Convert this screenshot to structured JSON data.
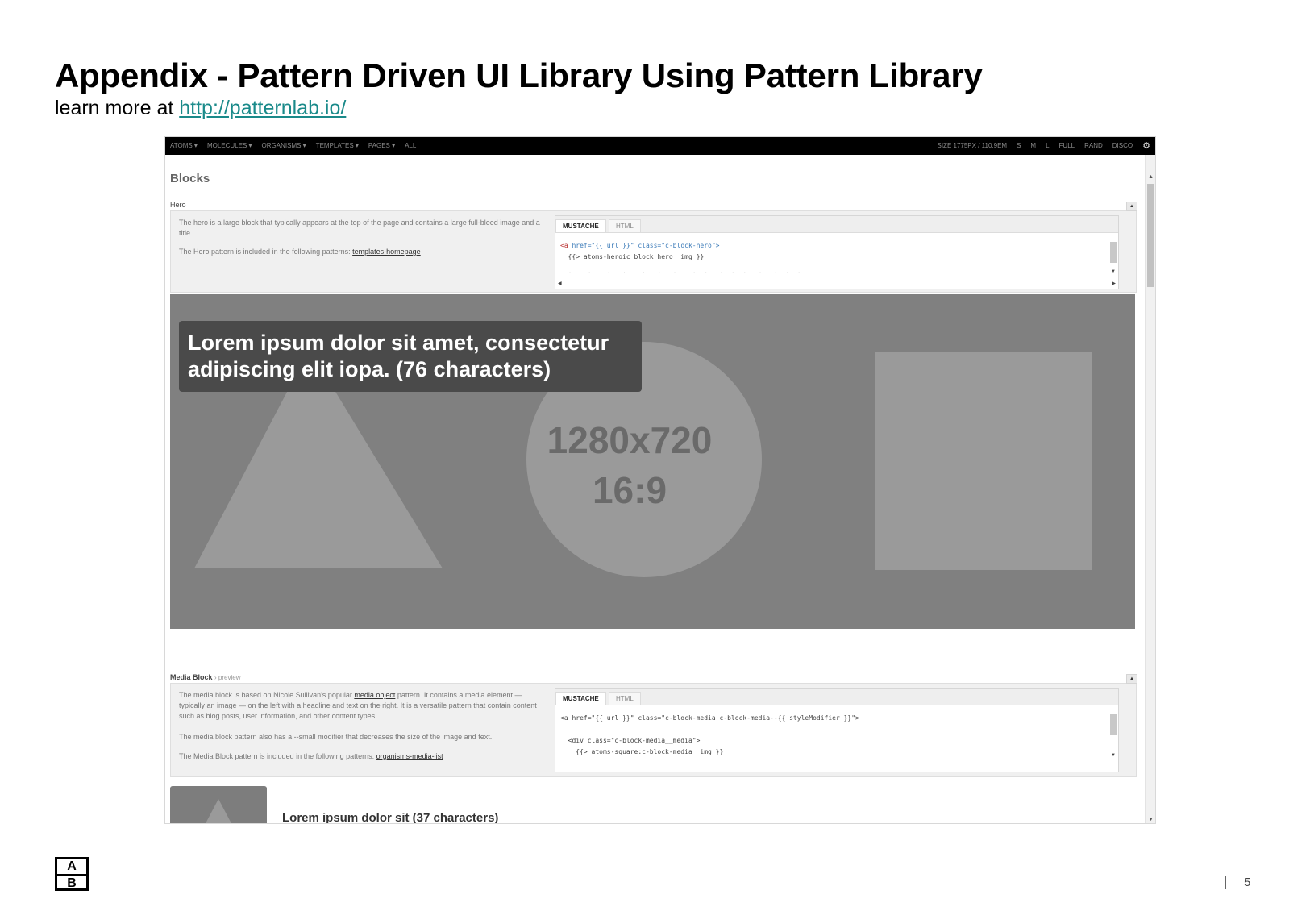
{
  "slide": {
    "title": "Appendix - Pattern Driven UI Library Using Pattern Library",
    "subtitle_prefix": "learn more at ",
    "subtitle_link": "http://patternlab.io/",
    "page_number": "5",
    "logo_top": "A",
    "logo_bottom": "B"
  },
  "nav": {
    "items": [
      "ATOMS ▾",
      "MOLECULES ▾",
      "ORGANISMS ▾",
      "TEMPLATES ▾",
      "PAGES ▾",
      "ALL"
    ],
    "size_readout": "SIZE 1775PX / 110.9EM",
    "right_items": [
      "S",
      "M",
      "L",
      "FULL",
      "RAND",
      "DISCO"
    ],
    "gear_icon": "gear-icon"
  },
  "page": {
    "heading": "Blocks",
    "hero_label": "Hero",
    "hero_desc": "The hero is a large block that typically appears at the top of the page and contains a large full-bleed image and a title.",
    "hero_pattern_note": "The Hero pattern is included in the following patterns:",
    "hero_pattern_link": "templates-homepage",
    "tab_mustache": "MUSTACHE",
    "tab_html": "HTML",
    "hero_code_line1_tag": "<a",
    "hero_code_line1_rest": " href=\"{{ url }}\" class=\"c-block-hero\">",
    "hero_code_line2": "  {{> atoms-heroic block hero__img }}",
    "hero_code_line3": "  ·    ·    ·   ·    ·   ·   ·    ·  ·   ·  ·  ·   ·   ·  ·  ·",
    "hero_caption": "Lorem ipsum dolor sit amet, consectetur adipiscing elit iopa. (76 characters)",
    "hero_dims": "1280x720",
    "hero_ratio": "16:9",
    "media_label": "Media Block",
    "media_label_sub": "› preview",
    "media_desc_pre": "The media block is based on Nicole Sullivan's popular ",
    "media_desc_link": "media object",
    "media_desc_post": " pattern. It contains a media element — typically an image — on the left with a headline and text on the right. It is a versatile pattern that contain content such as blog posts, user information, and other content types.",
    "media_desc2": "The media block pattern also has a --small modifier that decreases the size of the image and text.",
    "media_pattern_note": "The Media Block pattern is included in the following patterns:",
    "media_pattern_link": "organisms-media-list",
    "media_code_line1": "<a href=\"{{ url }}\" class=\"c-block-media c-block-media--{{ styleModifier }}\">",
    "media_code_line2": "  <div class=\"c-block-media__media\">",
    "media_code_line3": "    {{> atoms-square:c-block-media__img }}",
    "media_title": "Lorem ipsum dolor sit (37 characters)"
  }
}
